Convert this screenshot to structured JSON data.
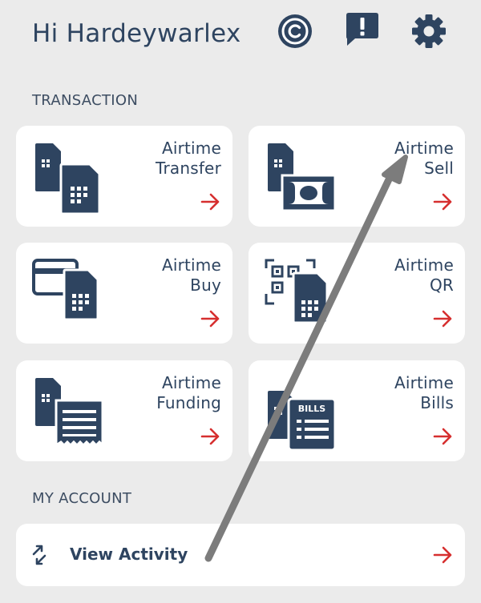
{
  "header": {
    "greeting": "Hi Hardeywarlex",
    "icons": [
      "copyright-icon",
      "alert-icon",
      "gear-icon"
    ]
  },
  "sections": {
    "transaction": "TRANSACTION",
    "account": "MY ACCOUNT"
  },
  "cards": [
    {
      "line1": "Airtime",
      "line2": "Transfer",
      "icon": "sim-transfer-icon"
    },
    {
      "line1": "Airtime",
      "line2": "Sell",
      "icon": "sim-cash-icon"
    },
    {
      "line1": "Airtime",
      "line2": "Buy",
      "icon": "card-sim-icon"
    },
    {
      "line1": "Airtime",
      "line2": "QR",
      "icon": "qr-sim-icon"
    },
    {
      "line1": "Airtime",
      "line2": "Funding",
      "icon": "sim-receipt-icon"
    },
    {
      "line1": "Airtime",
      "line2": "Bills",
      "icon": "sim-bills-icon"
    }
  ],
  "bills_badge": "BILLS",
  "activity": {
    "label": "View Activity",
    "icon": "swap-arrows-icon"
  },
  "colors": {
    "accent": "#d62f2f",
    "primary": "#2e4460",
    "background": "#ebebeb"
  }
}
